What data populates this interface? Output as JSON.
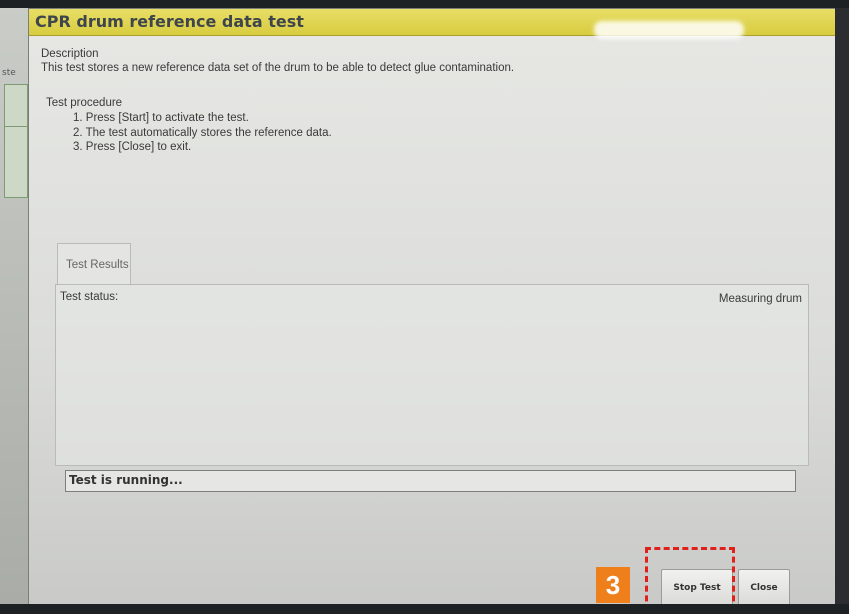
{
  "window": {
    "title": "CPR drum reference data test"
  },
  "description": {
    "heading": "Description",
    "text": "This test stores a new reference data set of the drum to be able to detect glue contamination."
  },
  "procedure": {
    "heading": "Test procedure",
    "steps": [
      "1. Press [Start] to activate the test.",
      "2. The test automatically stores the reference data.",
      "3. Press [Close] to exit."
    ]
  },
  "results": {
    "tab_label": "Test Results",
    "status_label": "Test status:",
    "status_value": "Measuring drum"
  },
  "running_text": "Test is running...",
  "buttons": {
    "stop": "Stop Test",
    "close": "Close"
  },
  "annotation": {
    "step_number": "3",
    "badge_color": "#ef7f1a",
    "highlight_color": "#e0201b"
  },
  "side_strip": {
    "labels": [
      "ste"
    ]
  },
  "colors": {
    "titlebar": "#d8cc3f",
    "title_text": "#3f454c",
    "dialog_bg": "#e7e8e4"
  }
}
